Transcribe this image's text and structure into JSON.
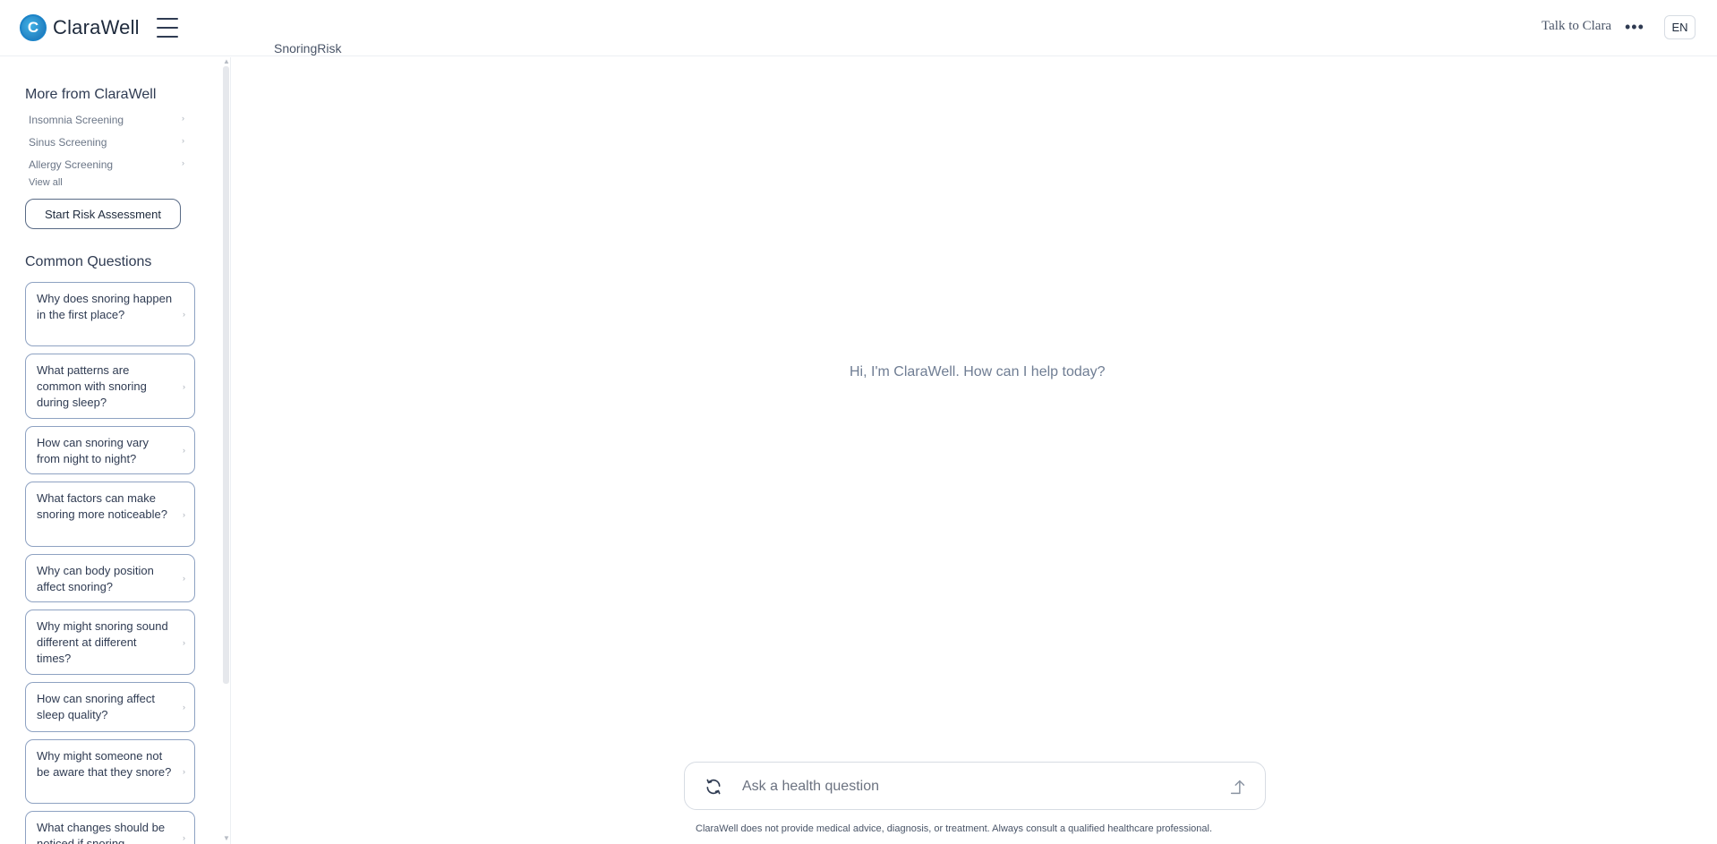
{
  "header": {
    "logo_letter": "C",
    "brand": "ClaraWell",
    "page_label": "SnoringRisk",
    "talk_link": "Talk to Clara",
    "more_icon": "more-horizontal-icon",
    "language": "EN"
  },
  "sidebar": {
    "more_title": "More from ClaraWell",
    "links": [
      {
        "label": "Insomnia Screening"
      },
      {
        "label": "Sinus Screening"
      },
      {
        "label": "Allergy Screening"
      }
    ],
    "view_all": "View all",
    "start_button": "Start Risk Assessment",
    "questions_title": "Common Questions",
    "questions": [
      {
        "label": "Why does snoring happen in the first place?"
      },
      {
        "label": "What patterns are common with snoring during sleep?"
      },
      {
        "label": "How can snoring vary from night to night?"
      },
      {
        "label": "What factors can make snoring more noticeable?"
      },
      {
        "label": "Why can body position affect snoring?"
      },
      {
        "label": "Why might snoring sound different at different times?"
      },
      {
        "label": "How can snoring affect sleep quality?"
      },
      {
        "label": "Why might someone not be aware that they snore?"
      },
      {
        "label": "What changes should be noticed if snoring"
      }
    ]
  },
  "main": {
    "greeting": "Hi, I'm ClaraWell. How can I help today?",
    "input_placeholder": "Ask a health question",
    "disclaimer": "ClaraWell does not provide medical advice, diagnosis, or treatment. Always consult a qualified healthcare professional."
  },
  "colors": {
    "accent": "#1b83c8",
    "card_border": "#8ea2c2",
    "text": "#2f3b52"
  }
}
